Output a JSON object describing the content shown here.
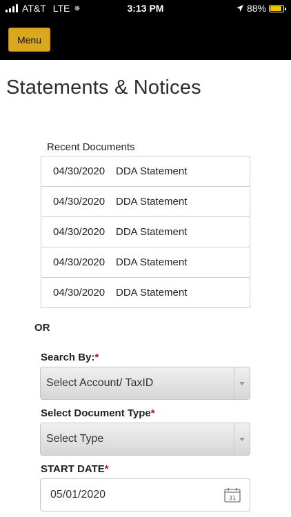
{
  "status_bar": {
    "carrier": "AT&T",
    "network": "LTE",
    "time": "3:13 PM",
    "battery": "88%",
    "battery_level": 0.88,
    "battery_color": "#f5c400"
  },
  "header": {
    "menu_label": "Menu",
    "accent_color": "#d9a81f"
  },
  "page": {
    "title": "Statements & Notices"
  },
  "recent": {
    "heading": "Recent Documents",
    "items": [
      {
        "date": "04/30/2020",
        "type": "DDA Statement"
      },
      {
        "date": "04/30/2020",
        "type": "DDA Statement"
      },
      {
        "date": "04/30/2020",
        "type": "DDA Statement"
      },
      {
        "date": "04/30/2020",
        "type": "DDA Statement"
      },
      {
        "date": "04/30/2020",
        "type": "DDA Statement"
      }
    ]
  },
  "or_label": "OR",
  "search_by": {
    "label": "Search By:",
    "required_mark": "*",
    "selected": "Select Account/ TaxID"
  },
  "document_type": {
    "label": "Select Document Type",
    "required_mark": "*",
    "selected": "Select Type"
  },
  "start_date": {
    "label": "START DATE",
    "required_mark": "*",
    "value": "05/01/2020",
    "calendar_day": "31"
  },
  "icons": {
    "signal": "cellular-signal-icon",
    "loading": "activity-spinner-icon",
    "location": "location-arrow-icon",
    "battery": "battery-icon",
    "dropdown": "chevron-down-icon",
    "calendar": "calendar-icon"
  }
}
